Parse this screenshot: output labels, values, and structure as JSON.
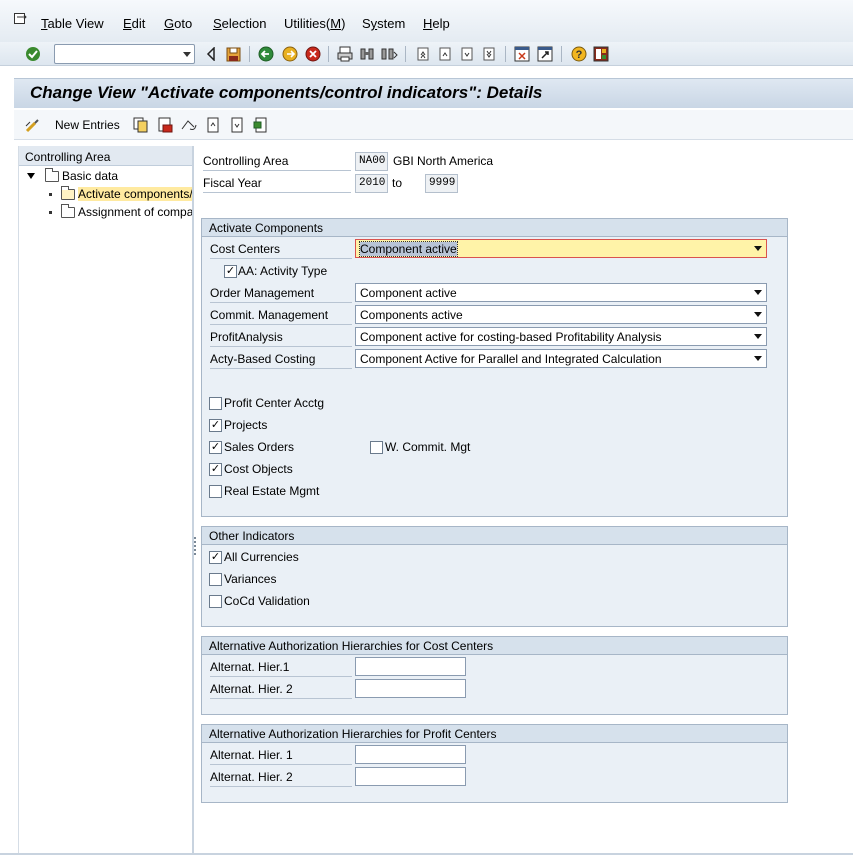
{
  "menu": {
    "items": [
      "Table View",
      "Edit",
      "Goto",
      "Selection",
      "Utilities(M)",
      "System",
      "Help"
    ],
    "mnemonics": [
      "T",
      "E",
      "G",
      "S",
      "M",
      "y",
      "H"
    ]
  },
  "toolbar": {
    "command_field": {
      "value": "",
      "placeholder": ""
    },
    "icons": [
      "enter-icon",
      "back-icon",
      "save-icon",
      "back-green-icon",
      "exit-icon",
      "cancel-icon",
      "print-icon",
      "find-icon",
      "find-next-icon",
      "first-page-icon",
      "previous-page-icon",
      "next-page-icon",
      "last-page-icon",
      "create-session-icon",
      "create-shortcut-icon",
      "help-icon",
      "customize-layout-icon"
    ]
  },
  "title": "Change View \"Activate components/control indicators\": Details",
  "app_toolbar": {
    "new_entries": "New Entries"
  },
  "tree": {
    "header": "Controlling Area",
    "nodes": [
      {
        "label": "Basic data"
      },
      {
        "label": "Activate components/control indicators"
      },
      {
        "label": "Assignment of company code(s)"
      }
    ]
  },
  "header_fields": {
    "controlling_area_label": "Controlling Area",
    "controlling_area_value": "NA00",
    "controlling_area_text": "GBI North America",
    "fiscal_year_label": "Fiscal Year",
    "fiscal_year_from": "2010",
    "fiscal_year_to_label": "to",
    "fiscal_year_to": "9999"
  },
  "activate_components": {
    "title": "Activate Components",
    "cost_centers_label": "Cost Centers",
    "cost_centers_value": "Component active",
    "aa_activity_type_label": "AA: Activity Type",
    "order_mgmt_label": "Order Management",
    "order_mgmt_value": "Component active",
    "commit_mgmt_label": "Commit. Management",
    "commit_mgmt_value": "Components active",
    "profit_analysis_label": "ProfitAnalysis",
    "profit_analysis_value": "Component active for costing-based Profitability Analysis",
    "acty_costing_label": "Acty-Based Costing",
    "acty_costing_value": "Component Active for Parallel and Integrated Calculation",
    "profit_center_label": "Profit Center Acctg",
    "projects_label": "Projects",
    "sales_orders_label": "Sales Orders",
    "w_commit_label": "W. Commit. Mgt",
    "cost_objects_label": "Cost Objects",
    "real_estate_label": "Real Estate Mgmt",
    "checked": {
      "aa": true,
      "profit_center": false,
      "projects": true,
      "sales_orders": true,
      "w_commit": false,
      "cost_objects": true,
      "real_estate": false
    }
  },
  "other_indicators": {
    "title": "Other Indicators",
    "all_currencies_label": "All Currencies",
    "variances_label": "Variances",
    "cocd_validation_label": "CoCd Validation",
    "checked": {
      "all_currencies": true,
      "variances": false,
      "cocd_validation": false
    }
  },
  "auth_cost_centers": {
    "title": "Alternative Authorization Hierarchies for Cost Centers",
    "hier1_label": "Alternat. Hier.1",
    "hier2_label": "Alternat. Hier. 2",
    "hier1_value": "",
    "hier2_value": ""
  },
  "auth_profit_centers": {
    "title": "Alternative Authorization Hierarchies for Profit Centers",
    "hier1_label": "Alternat. Hier. 1",
    "hier2_label": "Alternat. Hier. 2",
    "hier1_value": "",
    "hier2_value": ""
  },
  "check_mark": "✓",
  "colors": {
    "focus_field": "#fff3a8",
    "selected_node": "#ffeaa0",
    "group_bg": "#eaf0f6"
  }
}
